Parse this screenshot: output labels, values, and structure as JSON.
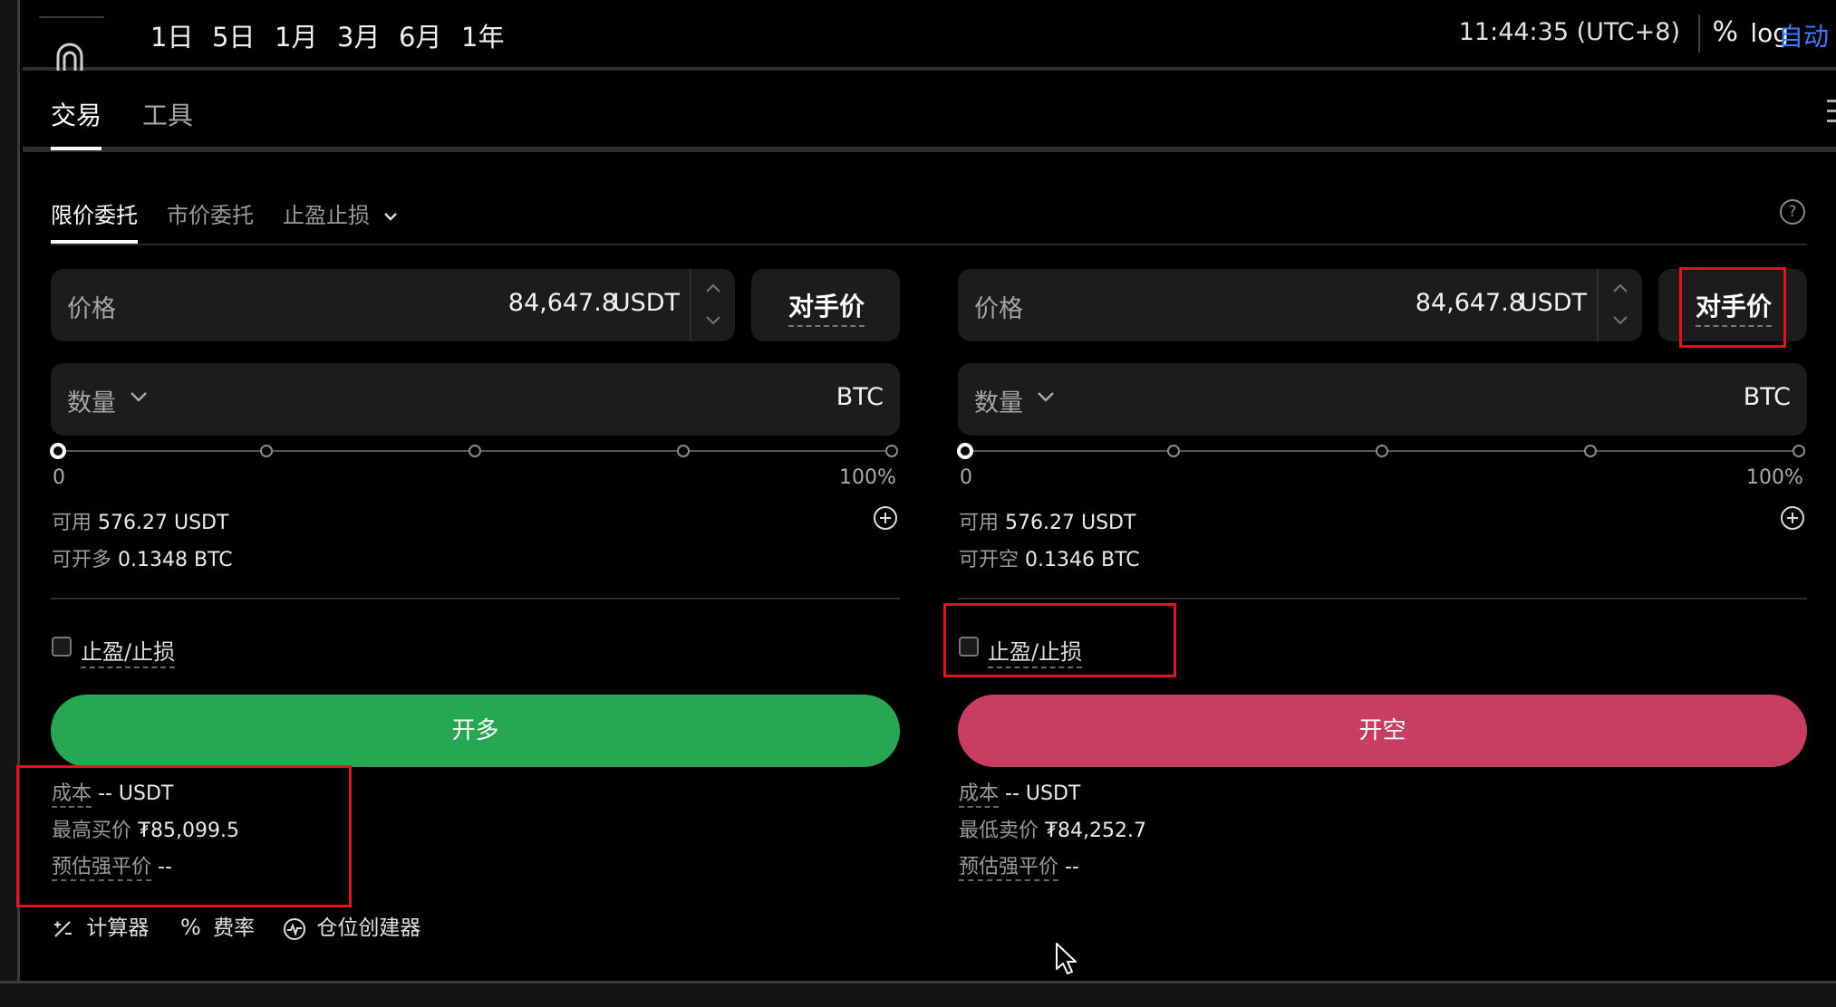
{
  "topbar": {
    "timeframes": [
      "1日",
      "5日",
      "1月",
      "3月",
      "6月",
      "1年"
    ],
    "clock": "11:44:35 (UTC+8)",
    "percent_label": "%",
    "log_label": "log",
    "auto_label": "自动",
    "auto_color": "#3c7bff"
  },
  "main_tabs": [
    "交易",
    "工具"
  ],
  "order_tabs": {
    "limit": "限价委托",
    "market": "市价委托",
    "tpsl": "止盈止损"
  },
  "help_icon": "?",
  "buy": {
    "price_label": "价格",
    "price_value": "84,647.8",
    "price_unit": "USDT",
    "counterparty_label": "对手价",
    "qty_label": "数量",
    "qty_unit": "BTC",
    "slider_min": "0",
    "slider_max": "100%",
    "slider_fraction": 0,
    "available_label": "可用",
    "available_value": "576.27 USDT",
    "max_label": "可开多",
    "max_value": "0.1348 BTC",
    "tpsl_label": "止盈/止损",
    "action_label": "开多",
    "action_color": "#27a752",
    "cost_label": "成本",
    "cost_value": "-- USDT",
    "best_price_label": "最高买价",
    "best_price_value": "₮85,099.5",
    "liq_label": "预估强平价",
    "liq_value": "--"
  },
  "sell": {
    "price_label": "价格",
    "price_value": "84,647.8",
    "price_unit": "USDT",
    "counterparty_label": "对手价",
    "qty_label": "数量",
    "qty_unit": "BTC",
    "slider_min": "0",
    "slider_max": "100%",
    "slider_fraction": 0,
    "available_label": "可用",
    "available_value": "576.27 USDT",
    "max_label": "可开空",
    "max_value": "0.1346 BTC",
    "tpsl_label": "止盈/止损",
    "action_label": "开空",
    "action_color": "#c83e63",
    "cost_label": "成本",
    "cost_value": "-- USDT",
    "best_price_label": "最低卖价",
    "best_price_value": "₮84,252.7",
    "liq_label": "预估强平价",
    "liq_value": "--"
  },
  "tools": {
    "calculator": "计算器",
    "fee_rate": "费率",
    "position_builder": "仓位创建器"
  },
  "highlight_color": "#e0141e"
}
